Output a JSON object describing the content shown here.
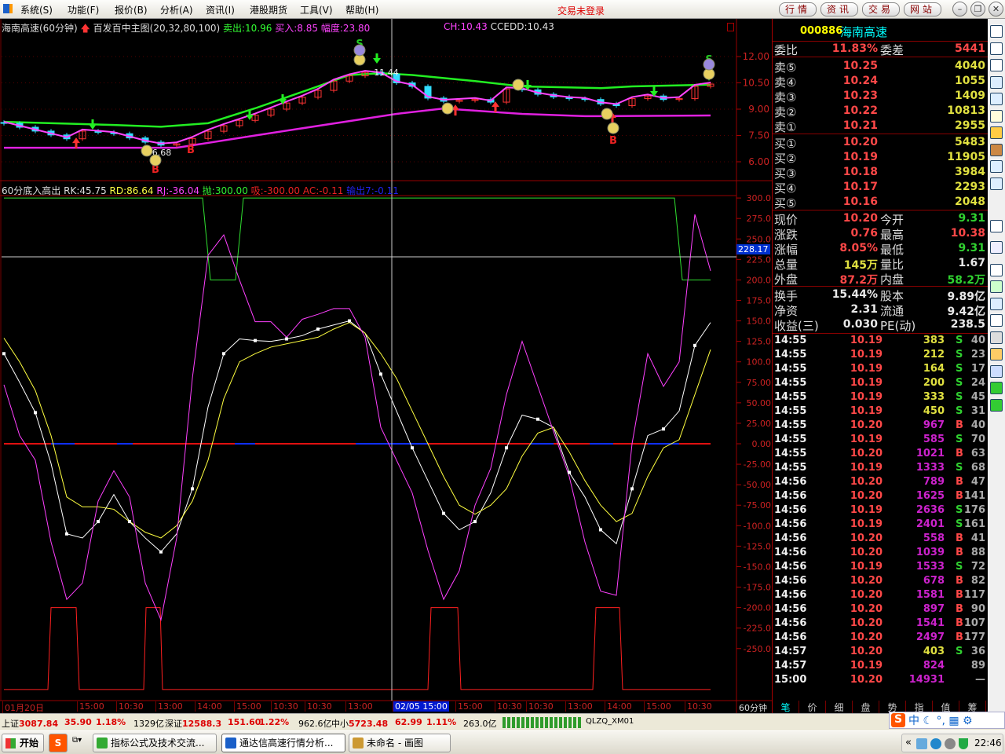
{
  "menubar": {
    "items": [
      "系统(S)",
      "功能(F)",
      "报价(B)",
      "分析(A)",
      "资讯(I)",
      "港股期货",
      "工具(V)",
      "帮助(H)"
    ],
    "login_status": "交易未登录",
    "buttons": [
      "行情",
      "资讯",
      "交易",
      "网站"
    ]
  },
  "main_chart": {
    "stock_title": "海南高速(60分钟)",
    "indicator_name": "百发百中主图(20,32,80,100)",
    "sell_label": "卖出:10.96",
    "buy_label": "买入:8.85",
    "range_label": "幅度:23.80",
    "ch_label": "CH:10.43",
    "ccedd_label": "CCEDD:10.43"
  },
  "sub_chart": {
    "name": "60分底入高出",
    "rk": "RK:45.75",
    "rd": "RD:86.64",
    "rj": "RJ:-36.04",
    "pao": "抛:300.00",
    "xi": "吸:-300.00",
    "ac": "AC:-0.11",
    "out": "输出7:-0.11",
    "crosshair_value": "228.17"
  },
  "chart_data": [
    {
      "type": "candlestick",
      "title": "海南高速(60分钟)",
      "ylim": [
        5.5,
        13
      ],
      "yticks": [
        "12.00",
        "10.50",
        "9.00",
        "7.50",
        "6.00"
      ],
      "ytick_values": [
        12,
        10.5,
        9,
        7.5,
        6
      ],
      "close": [
        8.19,
        7.97,
        7.75,
        7.53,
        7.31,
        7.75,
        7.68,
        7.6,
        7.36,
        7.12,
        6.95,
        7.02,
        7.33,
        7.74,
        8.06,
        8.36,
        8.66,
        9.0,
        9.35,
        9.68,
        10.07,
        10.6,
        10.9,
        11.1,
        11.0,
        10.5,
        10.3,
        9.63,
        9.45,
        9.5,
        9.55,
        9.4,
        10.15,
        10.1,
        9.85,
        9.7,
        9.6,
        9.55,
        9.3,
        9.2,
        9.6,
        9.75,
        9.55,
        9.6,
        10.3,
        10.43
      ],
      "upper_band": [
        [
          0,
          8.28
        ],
        [
          7,
          8.1
        ],
        [
          10,
          8.0
        ],
        [
          13,
          8.2
        ],
        [
          16,
          9.05
        ],
        [
          20,
          10.3
        ],
        [
          22,
          10.95
        ],
        [
          24,
          11.05
        ],
        [
          26,
          10.95
        ],
        [
          30,
          10.6
        ],
        [
          33,
          10.3
        ],
        [
          38,
          10.2
        ],
        [
          40,
          10.3
        ],
        [
          45,
          10.4
        ]
      ],
      "lower_band": [
        [
          0,
          6.8
        ],
        [
          11,
          6.8
        ],
        [
          16,
          7.5
        ],
        [
          25,
          8.73
        ],
        [
          28,
          9.04
        ],
        [
          33,
          8.73
        ],
        [
          37,
          8.6
        ],
        [
          45,
          8.64
        ]
      ],
      "markers": [
        {
          "kind": "text-sell",
          "idx": 22.65,
          "price": 12.76,
          "text": "S"
        },
        {
          "kind": "text-sell",
          "idx": 44.9,
          "price": 11.87,
          "text": "S"
        },
        {
          "kind": "text-buy",
          "idx": 9.65,
          "price": 5.6,
          "text": "B"
        },
        {
          "kind": "text-buy",
          "idx": 11.9,
          "price": 6.72,
          "text": "B"
        },
        {
          "kind": "text-buy",
          "idx": 38.8,
          "price": 7.25,
          "text": "B"
        },
        {
          "kind": "label",
          "idx": 24.35,
          "price": 11.1,
          "text": "11.44"
        },
        {
          "kind": "label",
          "idx": 10.05,
          "price": 6.54,
          "text": "6.68"
        },
        {
          "kind": "down-arrow",
          "idx": 5.65,
          "price": 8.06
        },
        {
          "kind": "down-arrow",
          "idx": 17.75,
          "price": 9.49
        },
        {
          "kind": "down-arrow",
          "idx": 15.65,
          "price": 8.6
        },
        {
          "kind": "down-arrow",
          "idx": 23.75,
          "price": 11.82
        },
        {
          "kind": "down-arrow",
          "idx": 33.35,
          "price": 10.3
        },
        {
          "kind": "down-arrow",
          "idx": 41.4,
          "price": 9.94
        },
        {
          "kind": "down-arrow",
          "idx": 44.9,
          "price": 10.84
        },
        {
          "kind": "up-arrow",
          "idx": 4.6,
          "price": 7.07
        },
        {
          "kind": "up-arrow",
          "idx": 28.75,
          "price": 8.95
        },
        {
          "kind": "up-arrow",
          "idx": 31.3,
          "price": 9.13
        },
        {
          "kind": "up-arrow",
          "idx": 38.75,
          "price": 8.5
        },
        {
          "kind": "smiley",
          "idx": 9.1,
          "price": 6.63
        },
        {
          "kind": "smiley",
          "idx": 9.65,
          "price": 6.09
        },
        {
          "kind": "smiley",
          "idx": 28.25,
          "price": 9.04
        },
        {
          "kind": "smiley",
          "idx": 38.4,
          "price": 8.73
        },
        {
          "kind": "smiley",
          "idx": 38.8,
          "price": 7.92
        },
        {
          "kind": "smiley",
          "idx": 22.65,
          "price": 11.82
        },
        {
          "kind": "smiley",
          "idx": 44.9,
          "price": 11.01
        },
        {
          "kind": "smiley",
          "idx": 32.75,
          "price": 10.39
        },
        {
          "kind": "smiley-purple",
          "idx": 22.65,
          "price": 12.36
        },
        {
          "kind": "smiley-purple",
          "idx": 44.9,
          "price": 11.55
        }
      ]
    },
    {
      "type": "line",
      "title": "60分底入高出",
      "ylim": [
        -300,
        300
      ],
      "yticks": [
        "300.0",
        "275.0",
        "250.0",
        "225.0",
        "200.0",
        "175.0",
        "150.0",
        "125.0",
        "100.0",
        "75.00",
        "50.00",
        "25.00",
        "0.00",
        "-25.00",
        "-50.00",
        "-75.00",
        "-100.0",
        "-125.0",
        "-150.0",
        "-175.0",
        "-200.0",
        "-225.0",
        "-250.0"
      ],
      "series": [
        {
          "name": "RK",
          "color": "#ffffff",
          "values": [
            110,
            75,
            38,
            -24,
            -110,
            -115,
            -95,
            -62,
            -95,
            -115,
            -132,
            -110,
            -55,
            45,
            110,
            128,
            126,
            125,
            128,
            132,
            140,
            145,
            150,
            135,
            85,
            40,
            -5,
            -45,
            -85,
            -105,
            -95,
            -60,
            -5,
            35,
            30,
            20,
            -35,
            -65,
            -105,
            -122,
            -55,
            10,
            18,
            40,
            120,
            148
          ]
        },
        {
          "name": "RD",
          "color": "#ffff40",
          "values": [
            129,
            100,
            65,
            10,
            -65,
            -77,
            -77,
            -80,
            -95,
            -108,
            -115,
            -100,
            -70,
            -20,
            55,
            100,
            110,
            118,
            122,
            126,
            130,
            140,
            148,
            135,
            110,
            80,
            40,
            0,
            -40,
            -75,
            -86,
            -75,
            -55,
            -15,
            13,
            20,
            -10,
            -45,
            -75,
            -95,
            -85,
            -40,
            -5,
            5,
            60,
            115
          ]
        },
        {
          "name": "RJ",
          "color": "#ff40ff",
          "values": [
            72,
            10,
            -20,
            -120,
            -190,
            -170,
            -70,
            -33,
            -65,
            -170,
            -215,
            -115,
            80,
            230,
            255,
            200,
            149,
            149,
            130,
            152,
            158,
            165,
            165,
            130,
            20,
            -20,
            -60,
            -130,
            -190,
            -155,
            -75,
            -30,
            60,
            125,
            70,
            15,
            -40,
            -120,
            -180,
            -185,
            0,
            110,
            70,
            100,
            280,
            211
          ]
        }
      ],
      "steps": [
        {
          "name": "抛",
          "color": "#30e030",
          "points": [
            [
              0,
              300
            ],
            [
              12.65,
              300
            ],
            [
              13.15,
              200
            ],
            [
              14.75,
              200
            ],
            [
              15.25,
              300
            ],
            [
              42.7,
              300
            ],
            [
              43.2,
              200
            ],
            [
              45,
              200
            ]
          ]
        },
        {
          "name": "吸",
          "color": "#ff2020",
          "points": [
            [
              0,
              -300
            ],
            [
              2.8,
              -300
            ],
            [
              3,
              -200
            ],
            [
              4.6,
              -200
            ],
            [
              4.8,
              -300
            ],
            [
              8.9,
              -300
            ],
            [
              9.05,
              -200
            ],
            [
              9.95,
              -200
            ],
            [
              10.1,
              -300
            ],
            [
              27,
              -300
            ],
            [
              27.2,
              -200
            ],
            [
              28.9,
              -200
            ],
            [
              29.1,
              -300
            ],
            [
              37.5,
              -300
            ],
            [
              37.7,
              -200
            ],
            [
              39.2,
              -200
            ],
            [
              39.4,
              -300
            ],
            [
              45,
              -300
            ]
          ]
        }
      ]
    }
  ],
  "time_axis": {
    "labels": [
      "01月20日",
      "15:00",
      "10:30",
      "13:00",
      "14:00",
      "15:00",
      "10:30",
      "10:30",
      "13:00",
      "02/05 15:00",
      "15:00",
      "10:30",
      "10:30",
      "13:00",
      "14:00",
      "15:00",
      "10:30"
    ],
    "period": "60分钟"
  },
  "quote": {
    "code": "000886",
    "name": "海南高速",
    "weibi_label": "委比",
    "weibi": "11.83%",
    "weicha_label": "委差",
    "weicha": "5441",
    "sells": [
      {
        "label": "卖⑤",
        "price": "10.25",
        "vol": "4040"
      },
      {
        "label": "卖④",
        "price": "10.24",
        "vol": "1055"
      },
      {
        "label": "卖③",
        "price": "10.23",
        "vol": "1409"
      },
      {
        "label": "卖②",
        "price": "10.22",
        "vol": "10813"
      },
      {
        "label": "卖①",
        "price": "10.21",
        "vol": "2955"
      }
    ],
    "buys": [
      {
        "label": "买①",
        "price": "10.20",
        "vol": "5483"
      },
      {
        "label": "买②",
        "price": "10.19",
        "vol": "11905"
      },
      {
        "label": "买③",
        "price": "10.18",
        "vol": "3984"
      },
      {
        "label": "买④",
        "price": "10.17",
        "vol": "2293"
      },
      {
        "label": "买⑤",
        "price": "10.16",
        "vol": "2048"
      }
    ],
    "stats": [
      {
        "l1": "现价",
        "v1": "10.20",
        "c1": "#ff4848",
        "l2": "今开",
        "v2": "9.31",
        "c2": "#30d030"
      },
      {
        "l1": "涨跌",
        "v1": "0.76",
        "c1": "#ff4848",
        "l2": "最高",
        "v2": "10.38",
        "c2": "#ff4848"
      },
      {
        "l1": "涨幅",
        "v1": "8.05%",
        "c1": "#ff4848",
        "l2": "最低",
        "v2": "9.31",
        "c2": "#30d030"
      },
      {
        "l1": "总量",
        "v1": "145万",
        "c1": "#e0e040",
        "l2": "量比",
        "v2": "1.67",
        "c2": "#e8e8e8"
      },
      {
        "l1": "外盘",
        "v1": "87.2万",
        "c1": "#ff4848",
        "l2": "内盘",
        "v2": "58.2万",
        "c2": "#30d030"
      },
      {
        "l1": "换手",
        "v1": "15.44%",
        "c1": "#e8e8e8",
        "l2": "股本",
        "v2": "9.89亿",
        "c2": "#e8e8e8"
      },
      {
        "l1": "净资",
        "v1": "2.31",
        "c1": "#e8e8e8",
        "l2": "流通",
        "v2": "9.42亿",
        "c2": "#e8e8e8"
      },
      {
        "l1": "收益(三)",
        "v1": "0.030",
        "c1": "#e8e8e8",
        "l2": "PE(动)",
        "v2": "238.5",
        "c2": "#e8e8e8"
      }
    ],
    "trades": [
      [
        "14:55",
        "10.19",
        "383",
        "S",
        "40"
      ],
      [
        "14:55",
        "10.19",
        "212",
        "S",
        "23"
      ],
      [
        "14:55",
        "10.19",
        "164",
        "S",
        "17"
      ],
      [
        "14:55",
        "10.19",
        "200",
        "S",
        "24"
      ],
      [
        "14:55",
        "10.19",
        "333",
        "S",
        "45"
      ],
      [
        "14:55",
        "10.19",
        "450",
        "S",
        "31"
      ],
      [
        "14:55",
        "10.20",
        "967",
        "B",
        "40"
      ],
      [
        "14:55",
        "10.19",
        "585",
        "S",
        "70"
      ],
      [
        "14:55",
        "10.20",
        "1021",
        "B",
        "63"
      ],
      [
        "14:55",
        "10.19",
        "1333",
        "S",
        "68"
      ],
      [
        "14:56",
        "10.20",
        "789",
        "B",
        "47"
      ],
      [
        "14:56",
        "10.20",
        "1625",
        "B",
        "141"
      ],
      [
        "14:56",
        "10.19",
        "2636",
        "S",
        "176"
      ],
      [
        "14:56",
        "10.19",
        "2401",
        "S",
        "161"
      ],
      [
        "14:56",
        "10.20",
        "558",
        "B",
        "41"
      ],
      [
        "14:56",
        "10.20",
        "1039",
        "B",
        "88"
      ],
      [
        "14:56",
        "10.19",
        "1533",
        "S",
        "72"
      ],
      [
        "14:56",
        "10.20",
        "678",
        "B",
        "82"
      ],
      [
        "14:56",
        "10.20",
        "1581",
        "B",
        "117"
      ],
      [
        "14:56",
        "10.20",
        "897",
        "B",
        "90"
      ],
      [
        "14:56",
        "10.20",
        "1541",
        "B",
        "107"
      ],
      [
        "14:56",
        "10.20",
        "2497",
        "B",
        "177"
      ],
      [
        "14:57",
        "10.20",
        "403",
        "S",
        "36"
      ],
      [
        "14:57",
        "10.19",
        "824",
        "",
        "89"
      ],
      [
        "15:00",
        "10.20",
        "14931",
        "",
        "—"
      ]
    ],
    "tabs": [
      "笔",
      "价",
      "细",
      "盘",
      "势",
      "指",
      "值",
      "筹"
    ]
  },
  "status_bar": {
    "sh_label": "上证",
    "sh_index": "3087.84",
    "sh_chg": "35.90",
    "sh_pct": "1.18%",
    "sh_amt": "1329亿",
    "sz_label": "深证",
    "sz_index": "12588.3",
    "sz_chg": "151.60",
    "sz_pct": "1.22%",
    "sz_amt": "962.6亿",
    "zx_label": "中小",
    "zx_index": "5723.48",
    "zx_chg": "62.99",
    "zx_pct": "1.11%",
    "zx_amt": "263.0亿",
    "server": "QLZQ_XM01",
    "ime": "中"
  },
  "taskbar": {
    "start": "开始",
    "tasks": [
      "指标公式及技术交流...",
      "通达信高速行情分析...",
      "未命名 - 画图"
    ],
    "clock": "22:46"
  }
}
